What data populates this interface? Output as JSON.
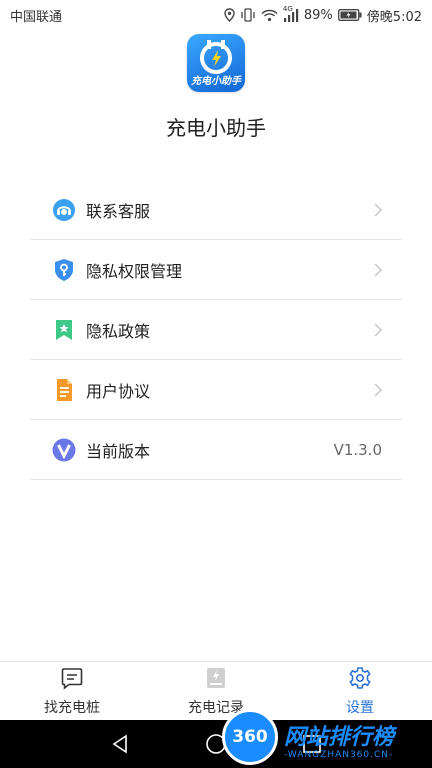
{
  "status_bar": {
    "carrier": "中国联通",
    "network": "4G",
    "battery": "89%",
    "time": "傍晚5:02"
  },
  "app": {
    "logo_text": "充电小助手",
    "name": "充电小助手"
  },
  "menu": [
    {
      "label": "联系客服",
      "icon": "headset-icon",
      "color": "#3aa0f0"
    },
    {
      "label": "隐私权限管理",
      "icon": "key-shield-icon",
      "color": "#3a8ff0"
    },
    {
      "label": "隐私政策",
      "icon": "bookmark-star-icon",
      "color": "#3ec98a"
    },
    {
      "label": "用户协议",
      "icon": "document-icon",
      "color": "#f59a2a"
    },
    {
      "label": "当前版本",
      "icon": "version-v-icon",
      "color": "#6a78e8",
      "value": "V1.3.0"
    }
  ],
  "bottom_nav": [
    {
      "label": "找充电桩",
      "icon": "chat-square-icon",
      "active": false
    },
    {
      "label": "充电记录",
      "icon": "charge-record-icon",
      "active": false
    },
    {
      "label": "设置",
      "icon": "gear-icon",
      "active": true
    }
  ],
  "colors": {
    "accent": "#2a73d6",
    "watermark": "#1a8cff"
  },
  "watermark": {
    "badge": "360",
    "title": "网站排行榜",
    "subtitle": "-WANGZHAN360.CN-"
  }
}
